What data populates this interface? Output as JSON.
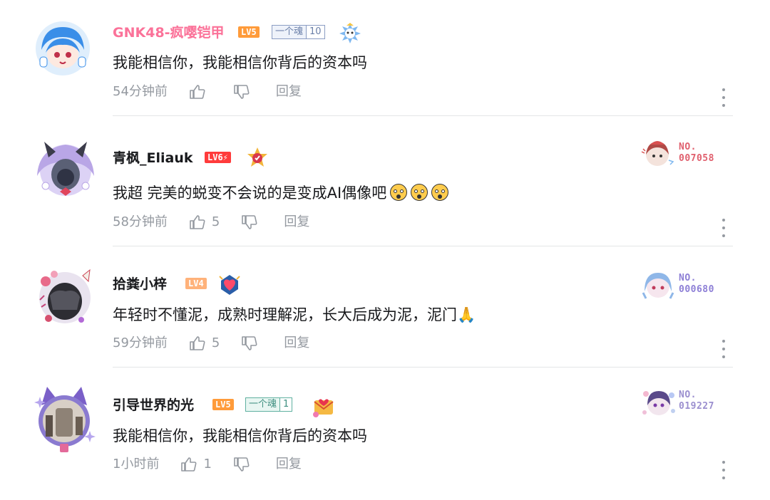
{
  "comments": [
    {
      "username": "GNK48-疯嘤铠甲",
      "name_color": "#fb7299",
      "level": "LV5",
      "level_color": "#ff9b3a",
      "fan_medal": {
        "name": "一个魂",
        "level": "10",
        "color": "#8b9dc3"
      },
      "text": "我能相信你，我能相信你背后的资本吗",
      "emojis": 0,
      "time": "54分钟前",
      "likes": "",
      "reply": "回复"
    },
    {
      "username": "青枫_Eliauk",
      "name_color": "#18191c",
      "level": "LV6⚡",
      "level_color": "#ff3b3b",
      "fan_medal": null,
      "text": "我超 完美的蜕变不会说的是变成AI偶像吧",
      "emojis": 3,
      "time": "58分钟前",
      "likes": "5",
      "reply": "回复",
      "badge_no": "NO.\n007058",
      "badge_color": "#e0606e"
    },
    {
      "username": "拾粪小梓",
      "name_color": "#18191c",
      "level": "LV4",
      "level_color": "#ffb27a",
      "fan_medal": null,
      "text": "年轻时不懂泥，成熟时理解泥，长大后成为泥，泥门🙏",
      "emojis": 0,
      "time": "59分钟前",
      "likes": "5",
      "reply": "回复",
      "badge_no": "NO.\n000680",
      "badge_color": "#8d7fd6"
    },
    {
      "username": "引导世界的光",
      "name_color": "#18191c",
      "level": "LV5",
      "level_color": "#ff9b3a",
      "fan_medal": {
        "name": "一个魂",
        "level": "1",
        "color": "#5fb0a0"
      },
      "text": "我能相信你，我能相信你背后的资本吗",
      "emojis": 0,
      "time": "1小时前",
      "likes": "1",
      "reply": "回复",
      "badge_no": "NO.\n019227",
      "badge_color": "#9b8fcf"
    }
  ],
  "icons": {
    "like": "thumbs-up-icon",
    "dislike": "thumbs-down-icon",
    "more": "more-vertical-icon"
  }
}
